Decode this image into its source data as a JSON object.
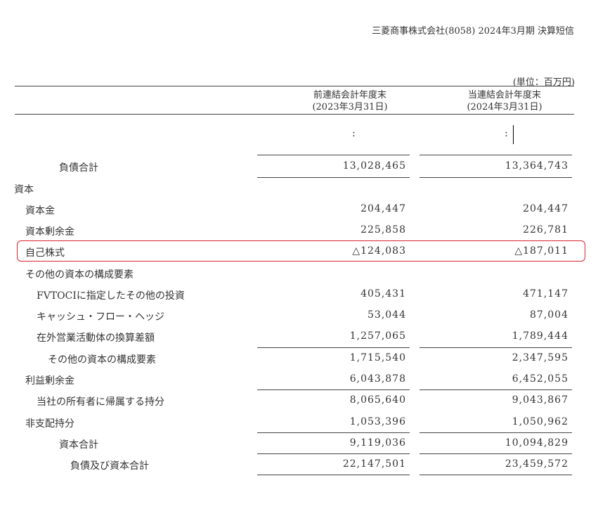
{
  "header": {
    "title": "三菱商事株式会社(8058) 2024年3月期 決算短信"
  },
  "unit_label": "(単位：百万円)",
  "columns": [
    {
      "line1": "前連結会計年度末",
      "line2": "(2023年3月31日)"
    },
    {
      "line1": "当連結会計年度末",
      "line2": "(2024年3月31日)"
    }
  ],
  "ellipsis": [
    ":",
    ":"
  ],
  "rows": [
    {
      "label": "負債合計",
      "prev": "13,028,465",
      "curr": "13,364,743"
    },
    {
      "label": "資本",
      "prev": "",
      "curr": ""
    },
    {
      "label": "資本金",
      "prev": "204,447",
      "curr": "204,447"
    },
    {
      "label": "資本剰余金",
      "prev": "225,858",
      "curr": "226,781"
    },
    {
      "label": "自己株式",
      "prev": "△124,083",
      "curr": "△187,011"
    },
    {
      "label": "その他の資本の構成要素",
      "prev": "",
      "curr": ""
    },
    {
      "label": "FVTOCIに指定したその他の投資",
      "prev": "405,431",
      "curr": "471,147"
    },
    {
      "label": "キャッシュ・フロー・ヘッジ",
      "prev": "53,044",
      "curr": "87,004"
    },
    {
      "label": "在外営業活動体の換算差額",
      "prev": "1,257,065",
      "curr": "1,789,444"
    },
    {
      "label": "その他の資本の構成要素",
      "prev": "1,715,540",
      "curr": "2,347,595"
    },
    {
      "label": "利益剰余金",
      "prev": "6,043,878",
      "curr": "6,452,055"
    },
    {
      "label": "当社の所有者に帰属する持分",
      "prev": "8,065,640",
      "curr": "9,043,867"
    },
    {
      "label": "非支配持分",
      "prev": "1,053,396",
      "curr": "1,050,962"
    },
    {
      "label": "資本合計",
      "prev": "9,119,036",
      "curr": "10,094,829"
    },
    {
      "label": "負債及び資本合計",
      "prev": "22,147,501",
      "curr": "23,459,572"
    }
  ],
  "colors": {
    "highlight": "#d9252e",
    "text": "#333333"
  }
}
